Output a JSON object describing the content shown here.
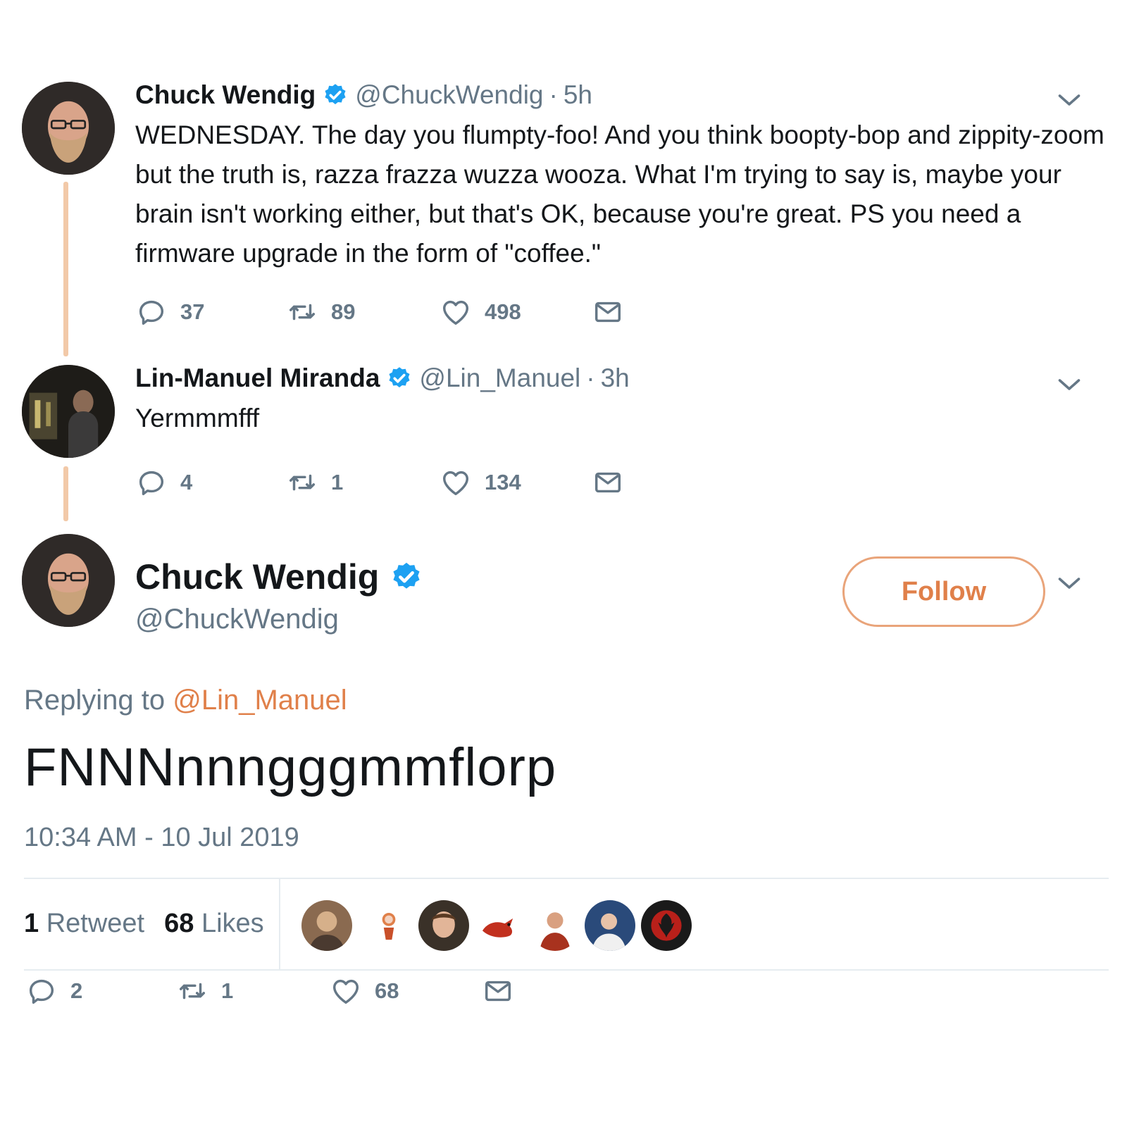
{
  "colors": {
    "accent": "#e0804a",
    "thread_line": "#f2c9a8",
    "verified": "#1da1f2",
    "muted": "#657786"
  },
  "tweets": [
    {
      "name": "Chuck Wendig",
      "handle": "@ChuckWendig",
      "dot": "·",
      "time": "5h",
      "text": "WEDNESDAY. The day you flumpty-foo! And you think boopty-bop and zippity-zoom but the truth is, razza frazza wuzza wooza. What I'm trying to say is, maybe your brain isn't working either, but that's OK, because you're great. PS you need a firmware upgrade in the form of \"coffee.\"",
      "replies": "37",
      "retweets": "89",
      "likes": "498"
    },
    {
      "name": "Lin-Manuel Miranda",
      "handle": "@Lin_Manuel",
      "dot": "·",
      "time": "3h",
      "text": "Yermmmfff",
      "replies": "4",
      "retweets": "1",
      "likes": "134"
    }
  ],
  "main": {
    "name": "Chuck Wendig",
    "handle": "@ChuckWendig",
    "follow_label": "Follow",
    "replying_prefix": "Replying to",
    "replying_to": "@Lin_Manuel",
    "text": "FNNNnnngggmmflorp",
    "timestamp": "10:34 AM - 10 Jul 2019",
    "retweet_count": "1",
    "retweet_label": "Retweet",
    "like_count": "68",
    "like_label": "Likes",
    "replies": "2",
    "retweets": "1",
    "likes": "68"
  },
  "icons": [
    "reply-icon",
    "retweet-icon",
    "like-icon",
    "dm-icon",
    "chevron-down-icon",
    "verified-badge-icon"
  ]
}
